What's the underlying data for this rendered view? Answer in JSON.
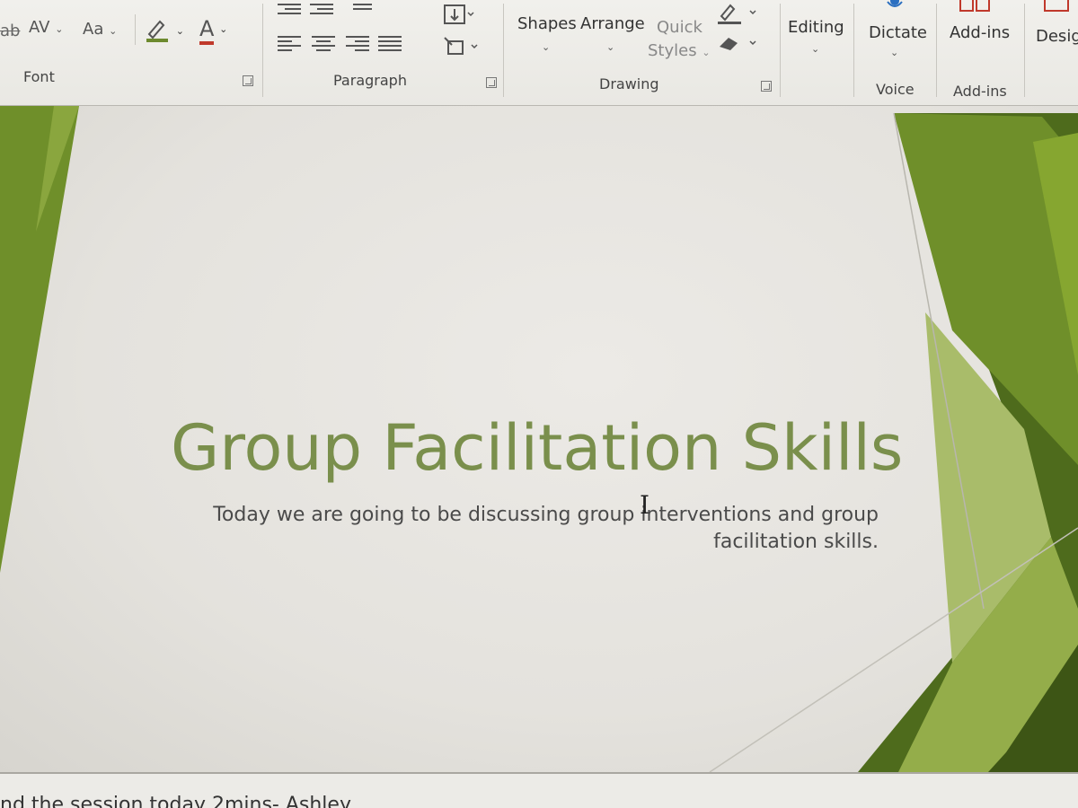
{
  "ribbon": {
    "font_group": {
      "label": "Font",
      "strike_icon": "ab",
      "char_spacing_label": "AV",
      "change_case_label": "Aa",
      "font_color_label": "A"
    },
    "paragraph_group": {
      "label": "Paragraph"
    },
    "drawing_group": {
      "label": "Drawing",
      "shapes_label": "Shapes",
      "arrange_label": "Arrange",
      "quick_styles_line1": "Quick",
      "quick_styles_line2": "Styles"
    },
    "editing": {
      "label": "Editing"
    },
    "voice_group": {
      "label": "Voice",
      "dictate_label": "Dictate"
    },
    "addins_group": {
      "label": "Add-ins",
      "addins_label": "Add-ins"
    },
    "designer": {
      "label": "Desig"
    }
  },
  "slide": {
    "title": "Group Facilitation Skills",
    "subtitle_line1": "Today we are going to be discussing group interventions and group",
    "subtitle_line2": "facilitation skills.",
    "cursor_glyph": "I",
    "accent_color": "#7a8f4c",
    "deco_dark_green": "#4e6b1c",
    "deco_mid_green": "#6f8f2a",
    "deco_light_green": "#a9bc6a"
  },
  "notes": {
    "text": "nd the session today 2mins- Ashley"
  }
}
